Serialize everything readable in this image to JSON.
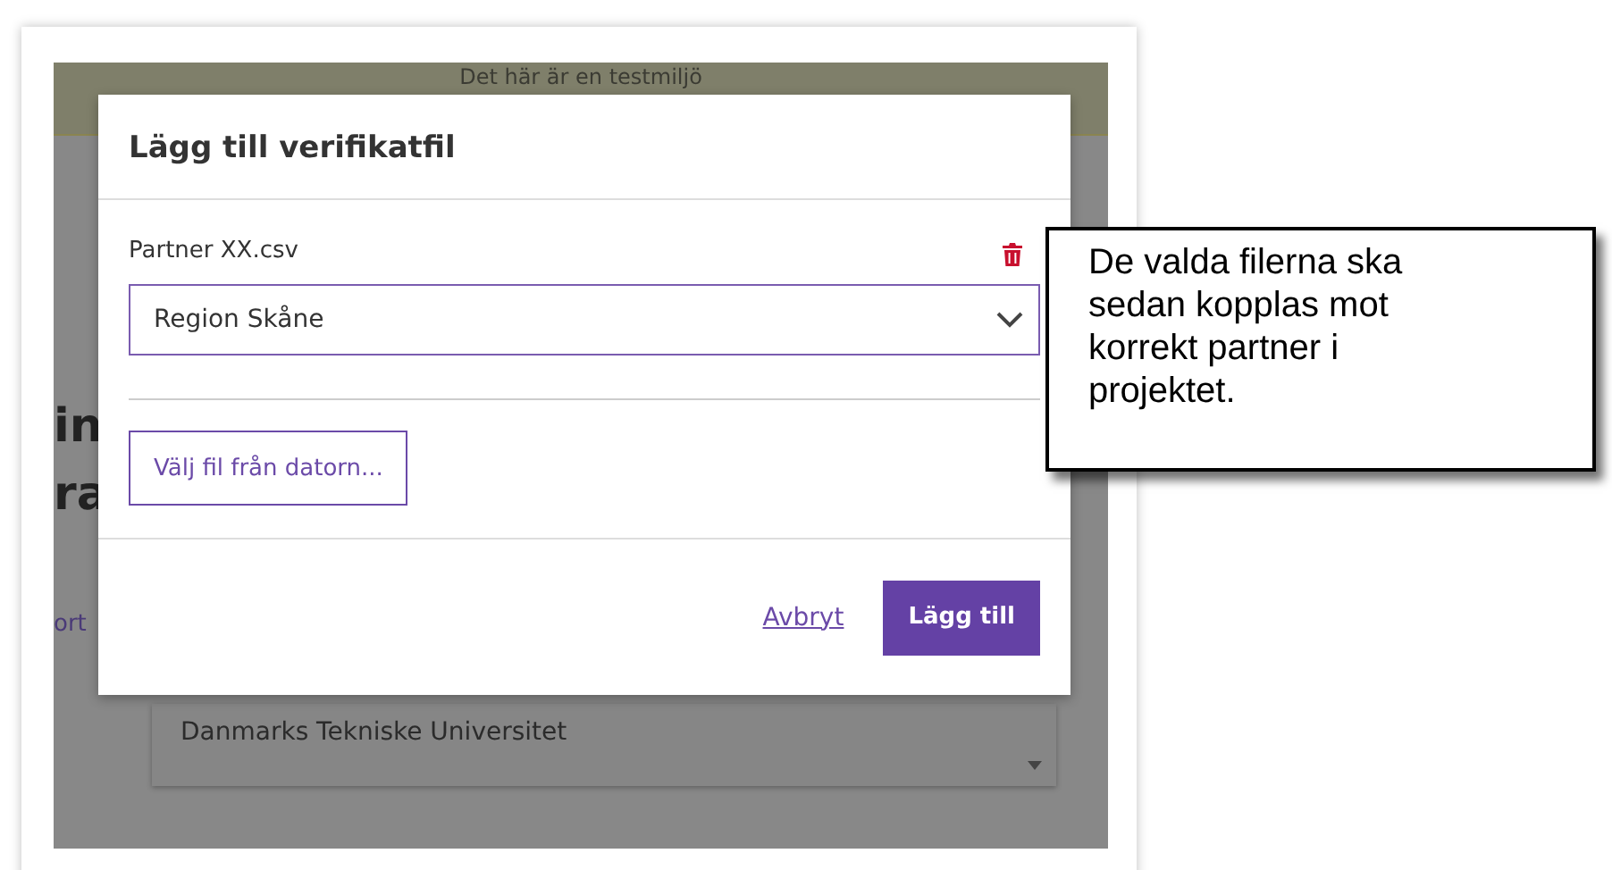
{
  "banner": {
    "text": "Det här är en testmiljö"
  },
  "background": {
    "fragments": [
      "in",
      "ra"
    ],
    "link_fragment": "ort",
    "list_items": [
      "Danmarks Tekniske Universitet"
    ]
  },
  "dialog": {
    "title": "Lägg till verifikatfil",
    "file": {
      "name": "Partner XX.csv"
    },
    "partner_select": {
      "value": "Region Skåne"
    },
    "choose_file_button": "Välj fil från datorn...",
    "cancel_link": "Avbryt",
    "submit_button": "Lägg till"
  },
  "callout": {
    "text": "De valda filerna ska sedan kopplas mot korrekt partner i projektet."
  }
}
